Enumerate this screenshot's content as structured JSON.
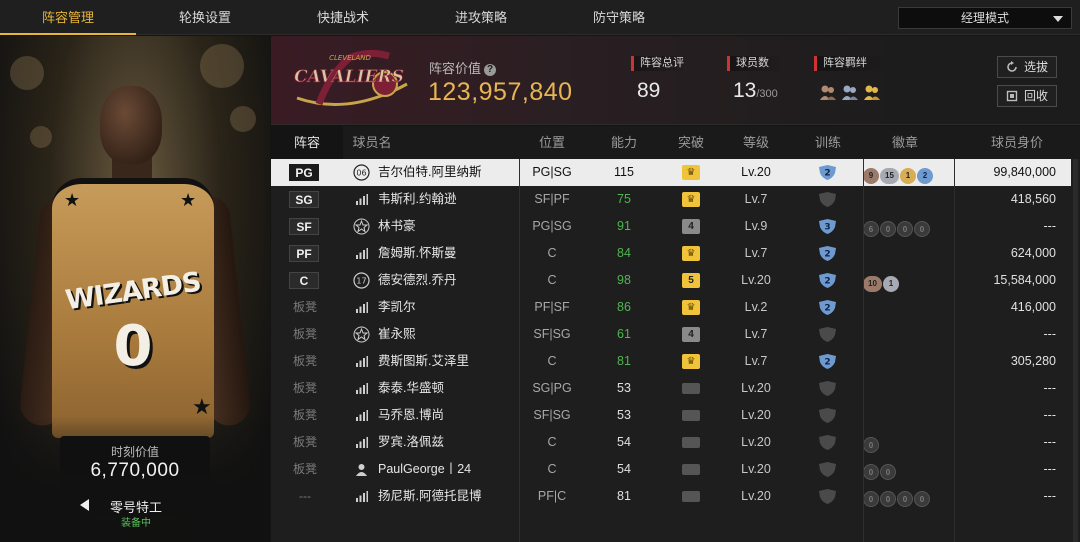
{
  "tabs": [
    {
      "label": "阵容管理",
      "active": true
    },
    {
      "label": "轮换设置",
      "active": false
    },
    {
      "label": "快捷战术",
      "active": false
    },
    {
      "label": "进攻策略",
      "active": false
    },
    {
      "label": "防守策略",
      "active": false
    }
  ],
  "mode_select": {
    "value": "经理模式"
  },
  "player_card": {
    "jersey_text": "WIZARDS",
    "jersey_number": "0",
    "moment_value_label": "时刻价值",
    "moment_value": "6,770,000",
    "card_name": "零号特工",
    "status": "装备中"
  },
  "team": {
    "logo_text": "CAVALIERS",
    "logo_sub_text": "CLEVELAND",
    "lineup_value_label": "阵容价值",
    "lineup_value": "123,957,840",
    "total_rating_label": "阵容总评",
    "total_rating": "89",
    "player_count_label": "球员数",
    "player_count": "13",
    "player_count_max": "/300",
    "bond_label": "阵容羁绊",
    "select_button": "选拔",
    "recycle_button": "回收"
  },
  "table": {
    "headers": [
      "阵容",
      "球员名",
      "位置",
      "能力",
      "突破",
      "等级",
      "训练",
      "徽章",
      "球员身价"
    ],
    "rows": [
      {
        "slot": "PG",
        "starter": true,
        "rank": "06",
        "rank_icon": "rank-06-badge-icon",
        "name": "吉尔伯特.阿里纳斯",
        "position": "PG|SG",
        "ability": "115",
        "ability_up": false,
        "breakthrough": "crown",
        "level": "Lv.20",
        "training": "2",
        "badges": [
          {
            "label": "9",
            "type": "bronze"
          },
          {
            "label": "15",
            "type": "silver"
          },
          {
            "label": "1",
            "type": "gold"
          },
          {
            "label": "2",
            "type": "blue"
          }
        ],
        "value": "99,840,000",
        "selected": true
      },
      {
        "slot": "SG",
        "starter": true,
        "rank": "",
        "rank_icon": "signal-bars-icon",
        "name": "韦斯利.约翰逊",
        "position": "SF|PF",
        "ability": "75",
        "ability_up": true,
        "breakthrough": "crown",
        "level": "Lv.7",
        "training": "",
        "badges": [],
        "value": "418,560",
        "selected": false
      },
      {
        "slot": "SF",
        "starter": true,
        "rank": "",
        "rank_icon": "star-badge-icon",
        "name": "林书豪",
        "position": "PG|SG",
        "ability": "91",
        "ability_up": true,
        "breakthrough": "4",
        "level": "Lv.9",
        "training": "3",
        "badges": [
          {
            "label": "6",
            "type": "dim"
          },
          {
            "label": "0",
            "type": "dim"
          },
          {
            "label": "0",
            "type": "dim"
          },
          {
            "label": "0",
            "type": "dim"
          }
        ],
        "value": "---",
        "selected": false
      },
      {
        "slot": "PF",
        "starter": true,
        "rank": "",
        "rank_icon": "signal-bars-icon",
        "name": "詹姆斯.怀斯曼",
        "position": "C",
        "ability": "84",
        "ability_up": true,
        "breakthrough": "crown",
        "level": "Lv.7",
        "training": "2",
        "badges": [],
        "value": "624,000",
        "selected": false
      },
      {
        "slot": "C",
        "starter": true,
        "rank": "17",
        "rank_icon": "rank-17-badge-icon",
        "name": "德安德烈.乔丹",
        "position": "C",
        "ability": "98",
        "ability_up": true,
        "breakthrough": "5",
        "level": "Lv.20",
        "training": "2",
        "badges": [
          {
            "label": "10",
            "type": "bronze"
          },
          {
            "label": "1",
            "type": "silver"
          }
        ],
        "value": "15,584,000",
        "selected": false
      },
      {
        "slot": "板凳",
        "starter": false,
        "rank": "",
        "rank_icon": "signal-bars-icon",
        "name": "李凯尔",
        "position": "PF|SF",
        "ability": "86",
        "ability_up": true,
        "breakthrough": "crown",
        "level": "Lv.2",
        "training": "2",
        "badges": [],
        "value": "416,000",
        "selected": false
      },
      {
        "slot": "板凳",
        "starter": false,
        "rank": "",
        "rank_icon": "star-badge-icon",
        "name": "崔永熙",
        "position": "SF|SG",
        "ability": "61",
        "ability_up": true,
        "breakthrough": "4",
        "level": "Lv.7",
        "training": "",
        "badges": [],
        "value": "---",
        "selected": false
      },
      {
        "slot": "板凳",
        "starter": false,
        "rank": "",
        "rank_icon": "signal-bars-icon",
        "name": "费斯图斯.艾泽里",
        "position": "C",
        "ability": "81",
        "ability_up": true,
        "breakthrough": "crown",
        "level": "Lv.7",
        "training": "2",
        "badges": [],
        "value": "305,280",
        "selected": false
      },
      {
        "slot": "板凳",
        "starter": false,
        "rank": "",
        "rank_icon": "signal-bars-icon",
        "name": "泰泰.华盛顿",
        "position": "SG|PG",
        "ability": "53",
        "ability_up": false,
        "breakthrough": "dash",
        "level": "Lv.20",
        "training": "",
        "badges": [],
        "value": "---",
        "selected": false
      },
      {
        "slot": "板凳",
        "starter": false,
        "rank": "",
        "rank_icon": "signal-bars-icon",
        "name": "马乔恩.博尚",
        "position": "SF|SG",
        "ability": "53",
        "ability_up": false,
        "breakthrough": "dash",
        "level": "Lv.20",
        "training": "",
        "badges": [],
        "value": "---",
        "selected": false
      },
      {
        "slot": "板凳",
        "starter": false,
        "rank": "",
        "rank_icon": "signal-bars-icon",
        "name": "罗宾.洛佩兹",
        "position": "C",
        "ability": "54",
        "ability_up": false,
        "breakthrough": "dash",
        "level": "Lv.20",
        "training": "",
        "badges": [
          {
            "label": "0",
            "type": "dim"
          }
        ],
        "value": "---",
        "selected": false
      },
      {
        "slot": "板凳",
        "starter": false,
        "rank": "",
        "rank_icon": "person-icon",
        "name": "PaulGeorge丨24",
        "position": "C",
        "ability": "54",
        "ability_up": false,
        "breakthrough": "dash",
        "level": "Lv.20",
        "training": "",
        "badges": [
          {
            "label": "0",
            "type": "dim"
          },
          {
            "label": "0",
            "type": "dim"
          }
        ],
        "value": "---",
        "selected": false
      },
      {
        "slot": "---",
        "starter": false,
        "rank": "",
        "rank_icon": "signal-bars-icon",
        "name": "扬尼斯.阿德托昆博",
        "position": "PF|C",
        "ability": "81",
        "ability_up": false,
        "breakthrough": "dash",
        "level": "Lv.20",
        "training": "",
        "badges": [
          {
            "label": "0",
            "type": "dim"
          },
          {
            "label": "0",
            "type": "dim"
          },
          {
            "label": "0",
            "type": "dim"
          },
          {
            "label": "0",
            "type": "dim"
          }
        ],
        "value": "---",
        "selected": false
      }
    ]
  },
  "colors": {
    "accent_gold": "#e7b53a",
    "lineup_value": "#e8b552",
    "ability_green": "#4fb54f",
    "stat_marker_red": "#cc3333",
    "equipped_green": "#5ac15a"
  }
}
